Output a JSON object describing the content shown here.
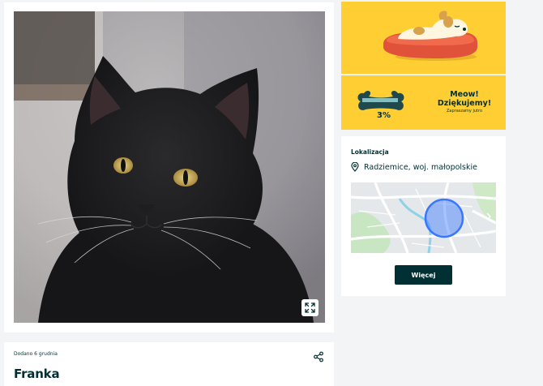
{
  "listing": {
    "added_label": "Dodano 6 grudnia",
    "title": "Franka"
  },
  "icons": {
    "expand": "expand-icon",
    "share": "share-icon",
    "location_pin": "location-pin-icon"
  },
  "promo": {
    "percent": "3%",
    "title_line1": "Meow!",
    "title_line2": "Dziękujemy!",
    "subtitle": "Zapraszamy jutro"
  },
  "location": {
    "heading": "Lokalizacja",
    "place": "Radziemice, woj. małopolskie",
    "more_button": "Więcej"
  },
  "colors": {
    "brand_dark": "#002f34",
    "promo_yellow": "#ffce32",
    "map_marker": "#3a77ff"
  }
}
